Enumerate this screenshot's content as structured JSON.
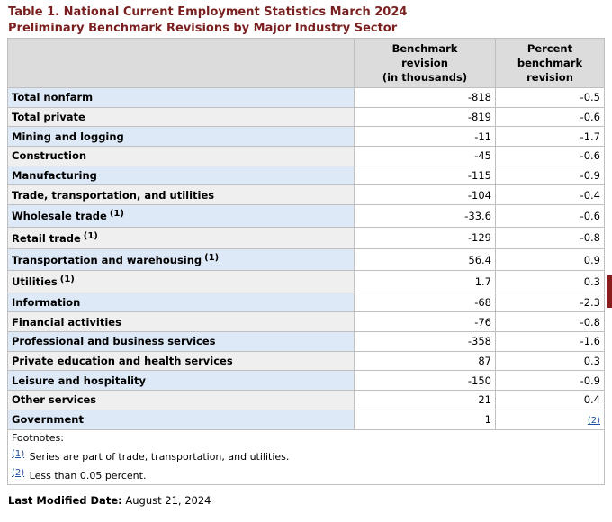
{
  "caption": {
    "line1": "Table 1. National Current Employment Statistics March 2024",
    "line2": "Preliminary Benchmark Revisions by Major Industry Sector"
  },
  "columns": {
    "c1": [
      "Benchmark",
      "revision",
      "(in thousands)"
    ],
    "c2": [
      "Percent",
      "benchmark",
      "revision"
    ]
  },
  "rows": [
    {
      "label": "Total nonfarm",
      "revision": "-818",
      "percent": "-0.5"
    },
    {
      "label": "Total private",
      "revision": "-819",
      "percent": "-0.6"
    },
    {
      "label": "Mining and logging",
      "revision": "-11",
      "percent": "-1.7"
    },
    {
      "label": "Construction",
      "revision": "-45",
      "percent": "-0.6"
    },
    {
      "label": "Manufacturing",
      "revision": "-115",
      "percent": "-0.9"
    },
    {
      "label": "Trade, transportation, and utilities",
      "revision": "-104",
      "percent": "-0.4"
    },
    {
      "label": "Wholesale trade",
      "note": "(1)",
      "revision": "-33.6",
      "percent": "-0.6"
    },
    {
      "label": "Retail trade",
      "note": "(1)",
      "revision": "-129",
      "percent": "-0.8"
    },
    {
      "label": "Transportation and warehousing",
      "note": "(1)",
      "revision": "56.4",
      "percent": "0.9"
    },
    {
      "label": "Utilities",
      "note": "(1)",
      "revision": "1.7",
      "percent": "0.3"
    },
    {
      "label": "Information",
      "revision": "-68",
      "percent": "-2.3"
    },
    {
      "label": "Financial activities",
      "revision": "-76",
      "percent": "-0.8"
    },
    {
      "label": "Professional and business services",
      "revision": "-358",
      "percent": "-1.6"
    },
    {
      "label": "Private education and health services",
      "revision": "87",
      "percent": "0.3"
    },
    {
      "label": "Leisure and hospitality",
      "revision": "-150",
      "percent": "-0.9"
    },
    {
      "label": "Other services",
      "revision": "21",
      "percent": "0.4"
    },
    {
      "label": "Government",
      "revision": "1",
      "percent": "(2)"
    }
  ],
  "footnotes": {
    "title": "Footnotes:",
    "items": [
      {
        "ref": "(1)",
        "text": "Series are part of trade, transportation, and utilities."
      },
      {
        "ref": "(2)",
        "text": "Less than 0.05 percent."
      }
    ]
  },
  "last_modified": {
    "label": "Last Modified Date:",
    "date": "August 21, 2024"
  }
}
